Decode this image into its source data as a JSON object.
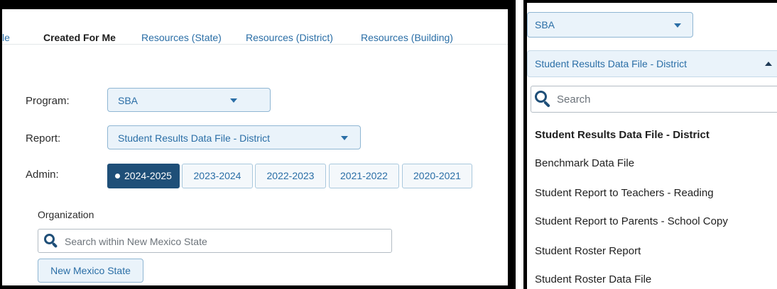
{
  "tabs": [
    "le",
    "Created For Me",
    "Resources (State)",
    "Resources (District)",
    "Resources (Building)"
  ],
  "form": {
    "program_label": "Program:",
    "program_value": "SBA",
    "report_label": "Report:",
    "report_value": "Student Results Data File - District",
    "admin_label": "Admin:",
    "admin_options": [
      "2024-2025",
      "2023-2024",
      "2022-2023",
      "2021-2022",
      "2020-2021"
    ],
    "admin_selected": "2024-2025"
  },
  "organization": {
    "label": "Organization",
    "search_placeholder": "Search within New Mexico State",
    "selected_org": "New Mexico State"
  },
  "dropdown_panel": {
    "program_value": "SBA",
    "report_value": "Student Results Data File - District",
    "search_placeholder": "Search",
    "options": [
      "Student Results Data File - District",
      "Benchmark Data File",
      "Student Report to Teachers - Reading",
      "Student Report to Parents - School Copy",
      "Student Roster Report",
      "Student Roster Data File"
    ],
    "selected_option": "Student Results Data File - District"
  },
  "colors": {
    "link_blue": "#2a6ea6",
    "selected_navy": "#1f4f78",
    "dropdown_bg": "#eaf3fa"
  }
}
